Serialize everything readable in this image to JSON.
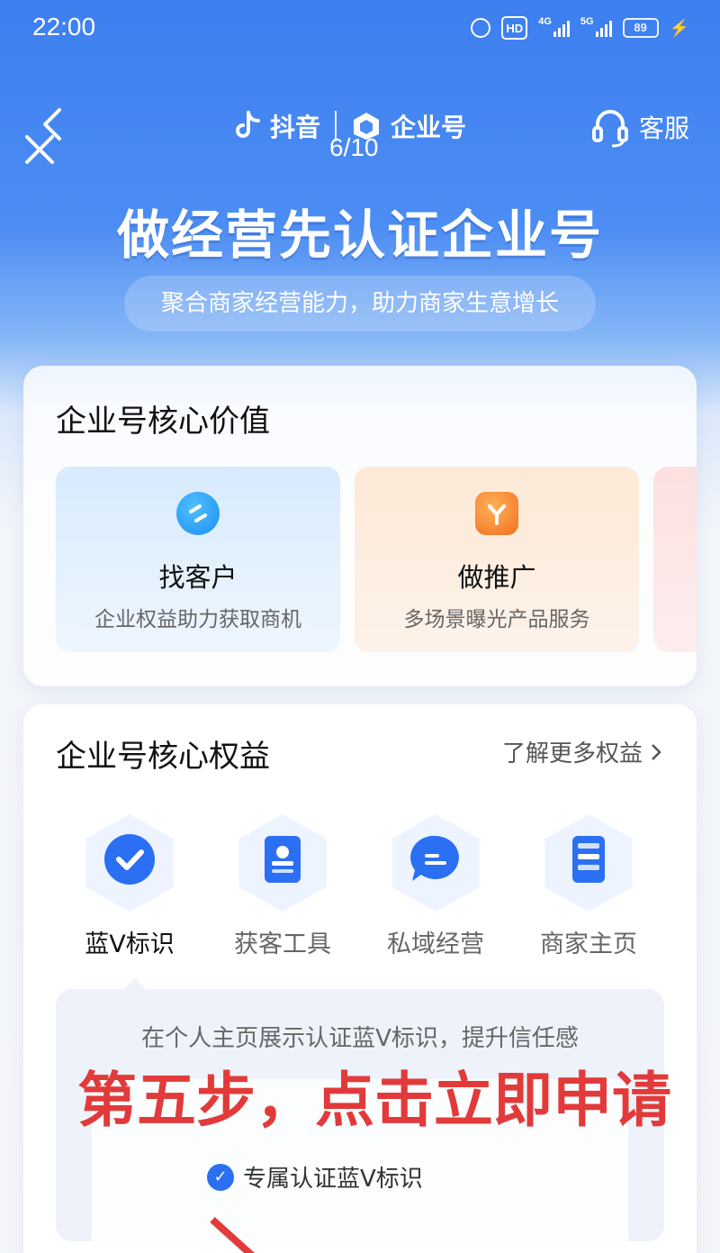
{
  "status_bar": {
    "time": "22:00",
    "hd": "HD",
    "network": "4G",
    "network2": "5G",
    "battery": "89"
  },
  "nav": {
    "brand_left": "抖音",
    "brand_right": "企业号",
    "page_counter": "6/10",
    "service_label": "客服"
  },
  "hero": {
    "title": "做经营先认证企业号",
    "subtitle": "聚合商家经营能力，助力商家生意增长"
  },
  "core_value": {
    "title": "企业号核心价值",
    "items": [
      {
        "name": "找客户",
        "desc": "企业权益助力获取商机",
        "icon": "customer-icon"
      },
      {
        "name": "做推广",
        "desc": "多场景曝光产品服务",
        "icon": "promotion-icon"
      }
    ]
  },
  "core_benefits": {
    "title": "企业号核心权益",
    "more_link": "了解更多权益",
    "items": [
      {
        "label": "蓝V标识",
        "icon": "blue-v-badge-icon"
      },
      {
        "label": "获客工具",
        "icon": "contact-card-icon"
      },
      {
        "label": "私域经营",
        "icon": "chat-bubble-icon"
      },
      {
        "label": "商家主页",
        "icon": "homepage-icon"
      }
    ],
    "detail_text": "在个人主页展示认证蓝V标识，提升信任感",
    "feature": "专属认证蓝V标识"
  },
  "annotation": {
    "text": "第五步，点击立即申请"
  },
  "colors": {
    "brand_blue": "#2b6ff2",
    "annotation_red": "#e23a3a"
  }
}
